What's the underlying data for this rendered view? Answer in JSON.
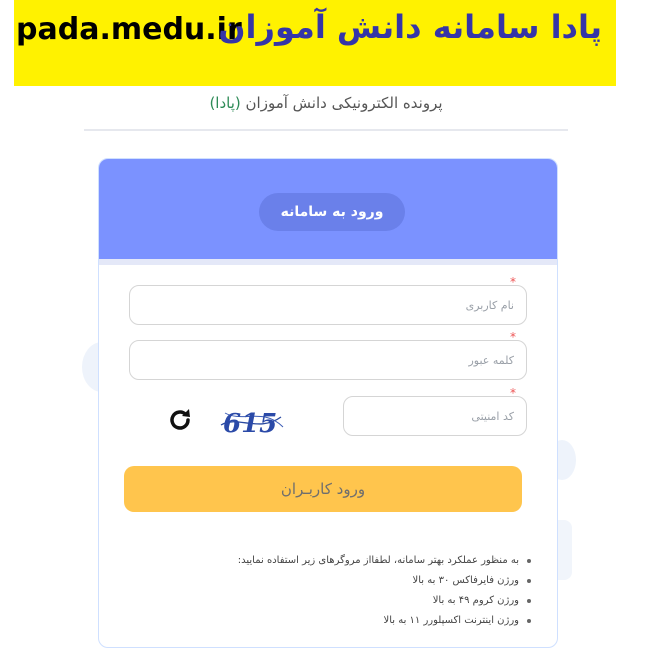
{
  "banner": {
    "url": "pada.medu.ir",
    "title": "پادا سامانه دانش آموزان",
    "background": "#fff200",
    "title_color": "#3535a8"
  },
  "subtitle": {
    "text": "پرونده الکترونیکی دانش آموزان",
    "acronym": "(پادا)"
  },
  "login_card": {
    "header_label": "ورود به سامانه",
    "header_color": "#7b92ff",
    "username": {
      "placeholder": "نام کاربری",
      "value": "",
      "required_mark": "*"
    },
    "password": {
      "placeholder": "کلمه عبور",
      "value": "",
      "required_mark": "*"
    },
    "security_code": {
      "placeholder": "کد امنیتی",
      "value": "",
      "required_mark": "*"
    },
    "captcha_text": "615",
    "refresh_icon": "refresh-icon",
    "submit_label": "ورود کاربـران",
    "submit_color": "#ffc54d"
  },
  "browser_notes": [
    "به منظور عملکرد بهتر سامانه، لطفااز مروگرهای زیر استفاده نمایید:",
    "ورژن فایرفاکس ۳۰ به بالا",
    "ورژن کروم ۴۹ به بالا",
    "ورژن اینترنت اکسپلورر ۱۱ به بالا"
  ]
}
